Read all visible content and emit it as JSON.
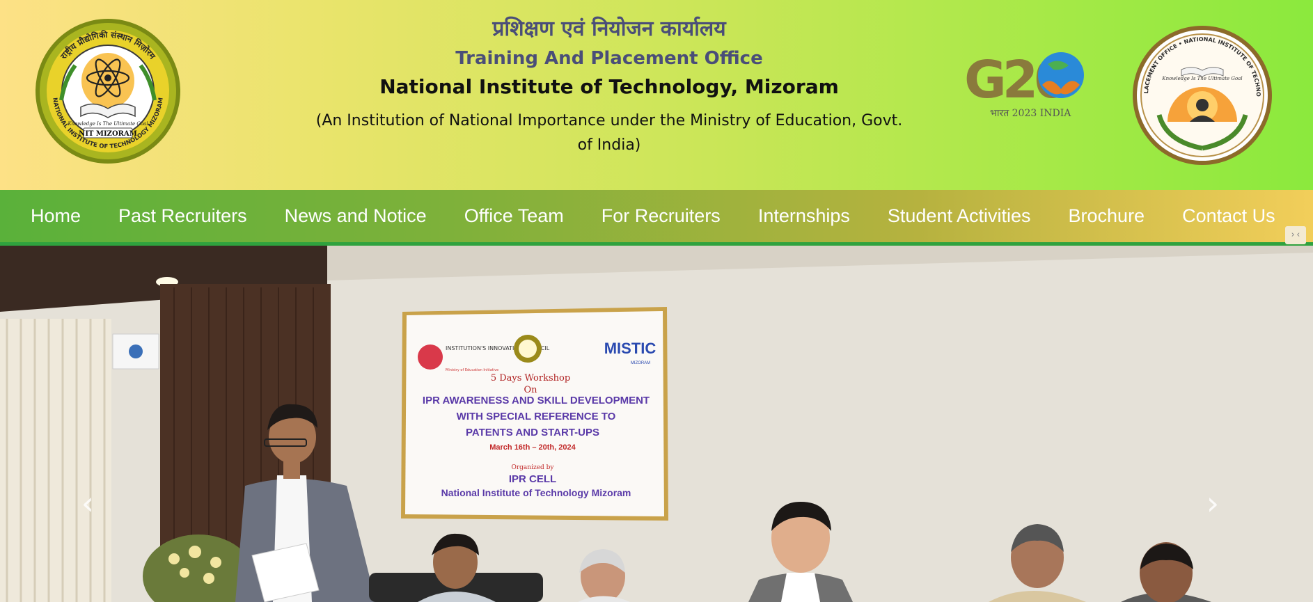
{
  "header": {
    "hindi_title": "प्रशिक्षण एवं नियोजन कार्यालय",
    "office": "Training And Placement Office",
    "institute": "National Institute of Technology, Mizoram",
    "note": "(An Institution of National Importance under the Ministry of Education, Govt. of India)",
    "logo_left": {
      "icon": "nit-mizoram-emblem",
      "ring_text": "राष्ट्रीय प्रौद्योगिकी संस्थान मिज़ोरम",
      "ring_text_en": "NATIONAL INSTITUTE OF TECHNOLOGY MIZORAM",
      "motto": "Knowledge Is The Ultimate Goal",
      "name": "NIT MIZORAM"
    },
    "g20": {
      "icon": "g20-logo",
      "mark": "G20",
      "caption": "भारत 2023 INDIA"
    },
    "logo_right": {
      "icon": "training-placement-emblem",
      "ring_text": "TRAINING AND PLACEMENT OFFICE • NATIONAL INSTITUTE OF TECHNOLOGY MIZORAM",
      "motto": "Knowledge Is The Ultimate Goal"
    }
  },
  "nav": {
    "items": [
      {
        "label": "Home"
      },
      {
        "label": "Past Recruiters"
      },
      {
        "label": "News and Notice"
      },
      {
        "label": "Office Team"
      },
      {
        "label": "For Recruiters"
      },
      {
        "label": "Internships"
      },
      {
        "label": "Student Activities"
      },
      {
        "label": "Brochure"
      },
      {
        "label": "Contact Us"
      }
    ],
    "toggle_icon": "collapse-icon",
    "toggle_glyph": "›‹"
  },
  "carousel": {
    "prev_icon": "chevron-left-icon",
    "next_icon": "chevron-right-icon",
    "prev_glyph": "‹",
    "next_glyph": "›",
    "banner": {
      "org_left": "INSTITUTION'S INNOVATION COUNCIL",
      "org_left_sub": "Ministry of Education Initiative",
      "org_right": "MISTIC",
      "org_right_sub": "MIZORAM",
      "line1": "5 Days Workshop",
      "line2": "On",
      "topic1": "IPR AWARENESS AND SKILL DEVELOPMENT",
      "topic2": "WITH SPECIAL REFERENCE TO",
      "topic3": "PATENTS AND START-UPS",
      "dates": "March 16th – 20th, 2024",
      "organized": "Organized by",
      "cell": "IPR CELL",
      "institute": "National Institute of Technology Mizoram"
    }
  },
  "colors": {
    "nav_text": "#ffffff",
    "title_blue": "#4a4e78",
    "nav_underline": "#2fa23e"
  }
}
